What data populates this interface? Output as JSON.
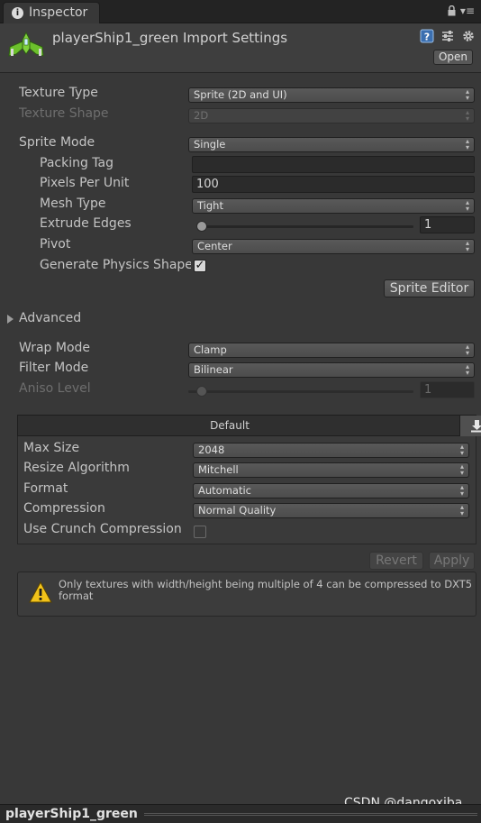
{
  "tab": {
    "title": "Inspector",
    "icon": "info-icon"
  },
  "header": {
    "title": "playerShip1_green Import Settings",
    "asset_icon": "player-ship-sprite-icon",
    "open_label": "Open"
  },
  "fields": {
    "texture_type": {
      "label": "Texture Type",
      "value": "Sprite (2D and UI)"
    },
    "texture_shape": {
      "label": "Texture Shape",
      "value": "2D"
    },
    "sprite_mode": {
      "label": "Sprite Mode",
      "value": "Single"
    },
    "packing_tag": {
      "label": "Packing Tag",
      "value": ""
    },
    "pixels_per_unit": {
      "label": "Pixels Per Unit",
      "value": "100"
    },
    "mesh_type": {
      "label": "Mesh Type",
      "value": "Tight"
    },
    "extrude_edges": {
      "label": "Extrude Edges",
      "value": "1",
      "level": 0.02
    },
    "pivot": {
      "label": "Pivot",
      "value": "Center"
    },
    "generate_physics_shape": {
      "label": "Generate Physics Shape",
      "checked": true
    },
    "sprite_editor_label": "Sprite Editor"
  },
  "advanced": {
    "label": "Advanced"
  },
  "wrap_mode": {
    "label": "Wrap Mode",
    "value": "Clamp"
  },
  "filter_mode": {
    "label": "Filter Mode",
    "value": "Bilinear"
  },
  "aniso_level": {
    "label": "Aniso Level",
    "value": "1",
    "level": 0.06
  },
  "platform": {
    "tab_label": "Default",
    "download_icon": "download-icon",
    "max_size": {
      "label": "Max Size",
      "value": "2048"
    },
    "resize_algorithm": {
      "label": "Resize Algorithm",
      "value": "Mitchell"
    },
    "format": {
      "label": "Format",
      "value": "Automatic"
    },
    "compression": {
      "label": "Compression",
      "value": "Normal Quality"
    },
    "crunch": {
      "label": "Use Crunch Compression",
      "checked": false
    }
  },
  "buttons": {
    "revert": "Revert",
    "apply": "Apply"
  },
  "warning": {
    "icon": "warning-icon",
    "text": "Only textures with width/height being multiple of 4 can be compressed to DXT5 format"
  },
  "footer": {
    "asset_name": "playerShip1_green"
  },
  "watermark": "CSDN @dangoxiba",
  "colors": {
    "background": "#383838",
    "panel": "#3e3e3e",
    "text": "#c4c4c4",
    "disabled_text": "#6e6e6e",
    "warning": "#f2c31a",
    "ship_green": "#7fd13b"
  }
}
